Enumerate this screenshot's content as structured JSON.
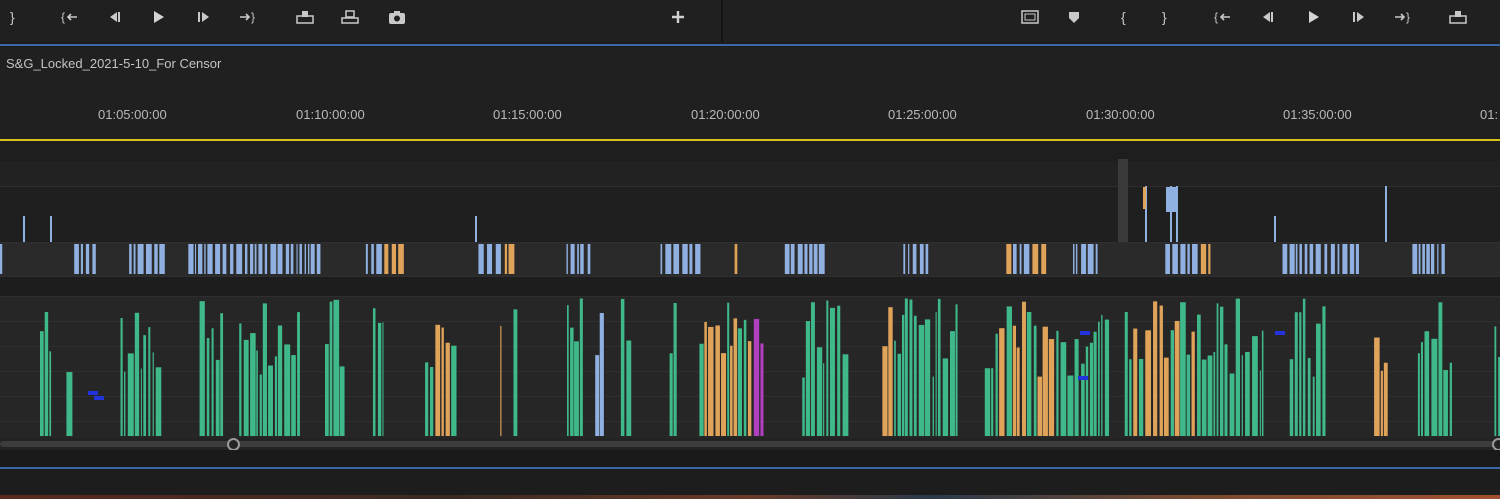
{
  "program_monitor": {
    "left_controls": [
      {
        "name": "mark-out-button",
        "glyph": "}"
      },
      {
        "name": "go-to-in-button",
        "glyph": "{←"
      },
      {
        "name": "step-back-button",
        "glyph": "◀|"
      },
      {
        "name": "play-button",
        "glyph": "▶"
      },
      {
        "name": "step-forward-button",
        "glyph": "|▶"
      },
      {
        "name": "go-to-out-button",
        "glyph": "→}"
      },
      {
        "name": "insert-button",
        "glyph": "insert"
      },
      {
        "name": "overwrite-button",
        "glyph": "overwrite"
      },
      {
        "name": "export-frame-button",
        "glyph": "camera"
      },
      {
        "name": "button-editor-button",
        "glyph": "+"
      }
    ],
    "right_controls": [
      {
        "name": "safe-margins-button",
        "glyph": "safe"
      },
      {
        "name": "add-marker-button",
        "glyph": "marker"
      },
      {
        "name": "mark-in-button",
        "glyph": "{"
      },
      {
        "name": "mark-out-button-right",
        "glyph": "}"
      },
      {
        "name": "go-to-in-button-right",
        "glyph": "{←"
      },
      {
        "name": "step-back-button-right",
        "glyph": "◀|"
      },
      {
        "name": "play-button-right",
        "glyph": "▶"
      },
      {
        "name": "step-forward-button-right",
        "glyph": "|▶"
      },
      {
        "name": "go-to-out-button-right",
        "glyph": "→}"
      },
      {
        "name": "insert-button-right",
        "glyph": "insert"
      }
    ]
  },
  "timeline": {
    "sequence_name": "S&G_Locked_2021-5-10_For Censor",
    "timecodes": [
      "01:05:00:00",
      "01:10:00:00",
      "01:15:00:00",
      "01:20:00:00",
      "01:25:00:00",
      "01:30:00:00",
      "01:35:00:00",
      "01:"
    ]
  },
  "colors": {
    "accent_blue": "#3a67a8",
    "playhead_yellow": "#d8c21a",
    "clip_blue": "#8fb0e0",
    "clip_orange": "#e0a35a",
    "clip_green": "#3fb98a",
    "clip_magenta": "#b040c0"
  }
}
